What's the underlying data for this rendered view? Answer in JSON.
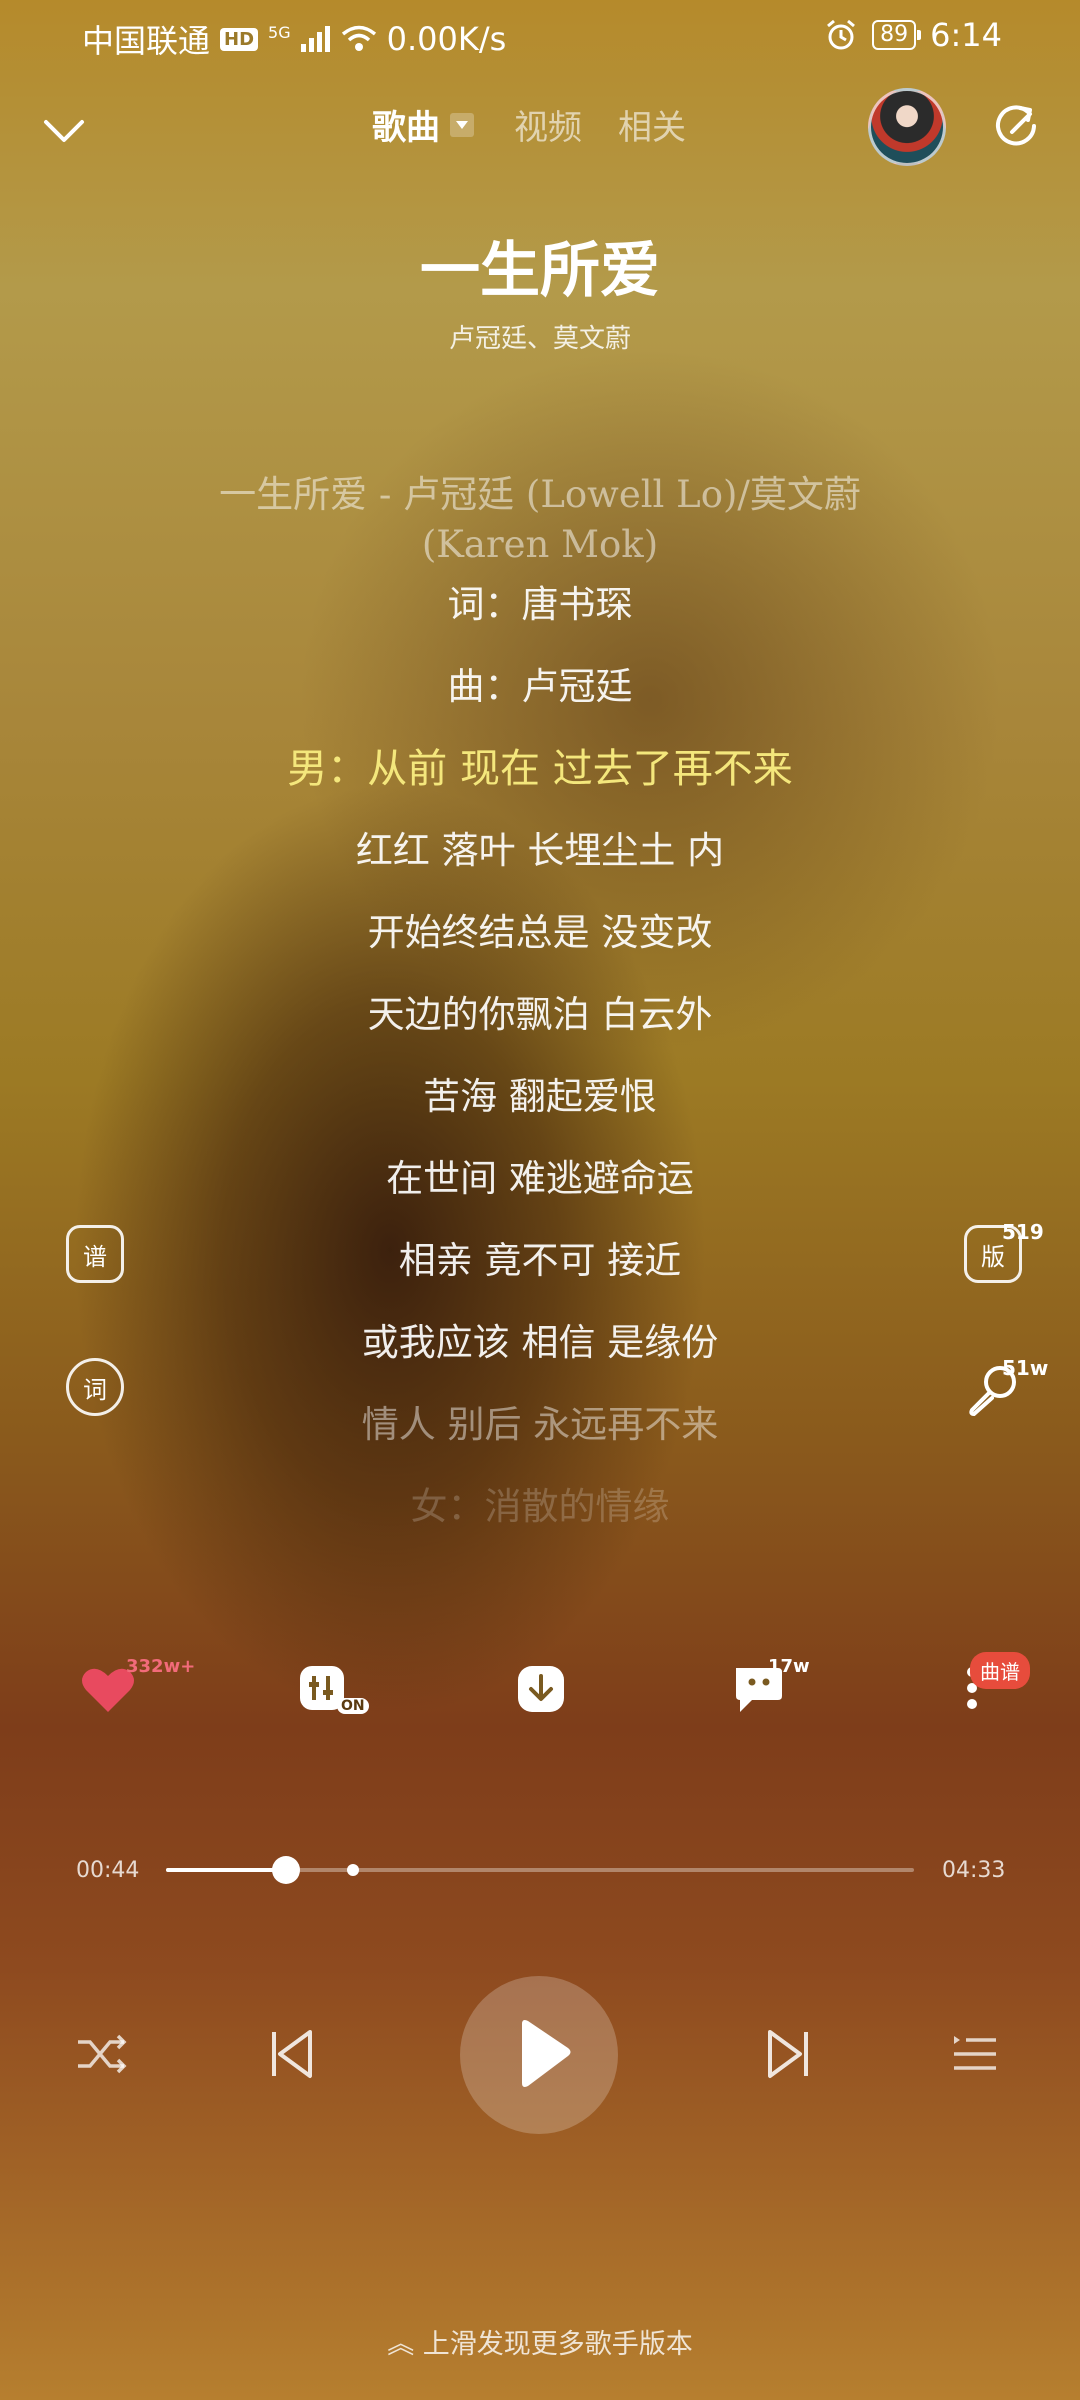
{
  "status_bar": {
    "carrier": "中国联通",
    "hd": "HD",
    "network": "5G",
    "speed": "0.00K/s",
    "battery": "89",
    "time": "6:14"
  },
  "header": {
    "tabs": [
      "歌曲",
      "视频",
      "相关"
    ],
    "active_tab": 0
  },
  "song": {
    "title": "一生所爱",
    "artists": "卢冠廷、莫文蔚"
  },
  "lyrics": {
    "lines": [
      {
        "text": "一生所爱 - 卢冠廷 (Lowell Lo)/莫文蔚 (Karen Mok)",
        "state": "dim"
      },
      {
        "text": "词：唐书琛",
        "state": "normal"
      },
      {
        "text": "曲：卢冠廷",
        "state": "normal"
      },
      {
        "text": "男：从前 现在 过去了再不来",
        "state": "current"
      },
      {
        "text": "红红 落叶 长埋尘土 内",
        "state": "normal"
      },
      {
        "text": "开始终结总是 没变改",
        "state": "normal"
      },
      {
        "text": "天边的你飘泊 白云外",
        "state": "normal"
      },
      {
        "text": "苦海 翻起爱恨",
        "state": "normal"
      },
      {
        "text": "在世间 难逃避命运",
        "state": "normal"
      },
      {
        "text": "相亲 竟不可 接近",
        "state": "normal"
      },
      {
        "text": "或我应该 相信 是缘份",
        "state": "normal"
      },
      {
        "text": "情人 别后 永远再不来",
        "state": "fade1"
      },
      {
        "text": "女：消散的情缘",
        "state": "fade2"
      }
    ]
  },
  "side_buttons": {
    "score_label": "谱",
    "lyric_label": "词",
    "version_label": "版",
    "version_count": "519",
    "mic_count": "51w"
  },
  "actions": {
    "like_count": "332w+",
    "effect_label": "ON",
    "comment_count": "17w",
    "more_badge": "曲谱"
  },
  "progress": {
    "current_time": "00:44",
    "total_time": "04:33",
    "played_fraction": 0.161,
    "marker_fraction": 0.25
  },
  "footer": {
    "hint": "上滑发现更多歌手版本"
  },
  "colors": {
    "current_lyric": "#f4e77c",
    "like": "#e84a5f",
    "badge": "#e74c3c"
  }
}
